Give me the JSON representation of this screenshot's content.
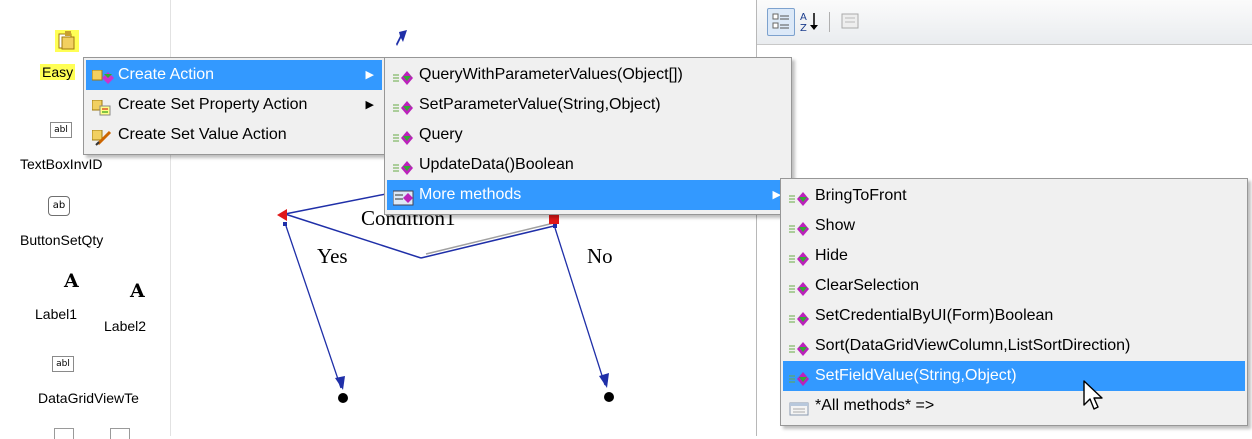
{
  "toolbox": {
    "items": [
      {
        "label": "Easy",
        "icon": "component-icon"
      },
      {
        "label": "TextBoxInvID",
        "icon": "textbox-icon",
        "icon_text": "abl"
      },
      {
        "label": "ButtonSetQty",
        "icon": "button-icon",
        "icon_text": "ab"
      },
      {
        "label": "Label1",
        "icon": "label-icon",
        "icon_text": "A"
      },
      {
        "label": "Label2",
        "icon": "label-icon",
        "icon_text": "A"
      },
      {
        "label": "DataGridViewTe",
        "icon": "textbox-icon",
        "icon_text": "abl"
      }
    ]
  },
  "canvas": {
    "condition_label": "Condition1",
    "yes_label": "Yes",
    "no_label": "No"
  },
  "context_menu": {
    "items": [
      {
        "label": "Create Action",
        "has_submenu": true,
        "highlighted": true
      },
      {
        "label": "Create Set Property Action",
        "has_submenu": true,
        "highlighted": false
      },
      {
        "label": "Create Set Value Action",
        "has_submenu": false,
        "highlighted": false
      }
    ]
  },
  "action_submenu": {
    "items": [
      {
        "label": "QueryWithParameterValues(Object[])",
        "highlighted": false
      },
      {
        "label": "SetParameterValue(String,Object)",
        "highlighted": false
      },
      {
        "label": "Query",
        "highlighted": false
      },
      {
        "label": "UpdateData()Boolean",
        "highlighted": false
      },
      {
        "label": "More methods",
        "has_submenu": true,
        "highlighted": true
      }
    ]
  },
  "methods_submenu": {
    "items": [
      {
        "label": "BringToFront",
        "highlighted": false
      },
      {
        "label": "Show",
        "highlighted": false
      },
      {
        "label": "Hide",
        "highlighted": false
      },
      {
        "label": "ClearSelection",
        "highlighted": false
      },
      {
        "label": "SetCredentialByUI(Form)Boolean",
        "highlighted": false
      },
      {
        "label": "Sort(DataGridViewColumn,ListSortDirection)",
        "highlighted": false
      },
      {
        "label": "SetFieldValue(String,Object)",
        "highlighted": true
      },
      {
        "label": "*All methods* =>",
        "highlighted": false
      }
    ]
  },
  "colors": {
    "menu_bg": "#f0f0f0",
    "highlight": "#3399ff",
    "selection_yellow": "#ffff55",
    "connector_blue": "#1f2fa8",
    "start_red": "#e01818"
  }
}
